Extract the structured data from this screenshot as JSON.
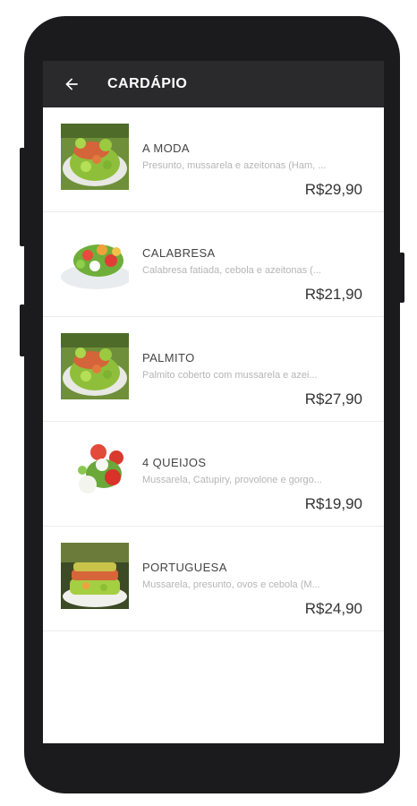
{
  "appbar": {
    "title": "CARDÁPIO",
    "back_icon": "arrow-left-icon"
  },
  "items": [
    {
      "name": "A MODA",
      "description": "Presunto, mussarela e azeitonas (Ham, ...",
      "price": "R$29,90",
      "image": "pizza-salad"
    },
    {
      "name": "CALABRESA",
      "description": "Calabresa fatiada, cebola e azeitonas (...",
      "price": "R$21,90",
      "image": "salad-plate"
    },
    {
      "name": "PALMITO",
      "description": "Palmito coberto com mussarela e azei...",
      "price": "R$27,90",
      "image": "pizza-salad"
    },
    {
      "name": "4 QUEIJOS",
      "description": "Mussarela, Catupiry, provolone e gorgo...",
      "price": "R$19,90",
      "image": "caprese-salad"
    },
    {
      "name": "PORTUGUESA",
      "description": "Mussarela, presunto, ovos e cebola (M...",
      "price": "R$24,90",
      "image": "layered-salad"
    }
  ],
  "colors": {
    "phone_frame": "#1b1b1d",
    "appbar": "#2a2a2c",
    "price_text": "#333333",
    "description_text": "#b5b5b5"
  }
}
